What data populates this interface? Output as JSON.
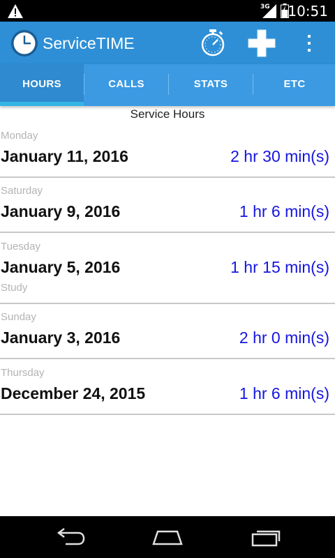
{
  "status_bar": {
    "network": "3G",
    "time": "10:51",
    "icons": [
      "warning-icon",
      "signal-icon",
      "battery-icon"
    ]
  },
  "app_bar": {
    "title": "ServiceTIME",
    "actions": [
      "stopwatch-icon",
      "add-icon",
      "overflow-menu-icon"
    ],
    "colors": {
      "bar": "#2e8fd6",
      "tabs": "#3b9ae2",
      "indicator": "#33b5e5"
    }
  },
  "tabs": [
    {
      "label": "HOURS",
      "active": true
    },
    {
      "label": "CALLS",
      "active": false
    },
    {
      "label": "STATS",
      "active": false
    },
    {
      "label": "ETC",
      "active": false
    }
  ],
  "section_title": "Service Hours",
  "entries": [
    {
      "day": "Monday",
      "date": "January 11, 2016",
      "duration": "2 hr 30 min(s)",
      "note": ""
    },
    {
      "day": "Saturday",
      "date": "January 9, 2016",
      "duration": "1 hr 6 min(s)",
      "note": ""
    },
    {
      "day": "Tuesday",
      "date": "January 5, 2016",
      "duration": "1 hr 15 min(s)",
      "note": "Study"
    },
    {
      "day": "Sunday",
      "date": "January 3, 2016",
      "duration": "2 hr 0 min(s)",
      "note": ""
    },
    {
      "day": "Thursday",
      "date": "December 24, 2015",
      "duration": "1 hr 6 min(s)",
      "note": ""
    }
  ],
  "nav_bar": {
    "buttons": [
      "back-icon",
      "home-icon",
      "recent-apps-icon"
    ]
  }
}
